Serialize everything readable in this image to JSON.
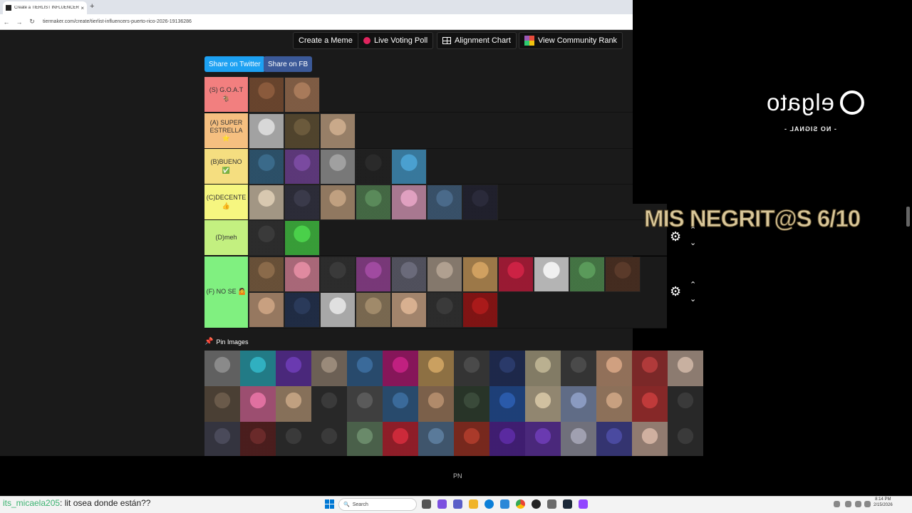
{
  "browser": {
    "tab_title": "Create a TIERLIST INFLUENCERS",
    "tab_close": "×",
    "new_tab": "+",
    "url": "tiermaker.com/create/tierlist-influencers-puerto-rico-2026-19136286",
    "nav": [
      "←",
      "→",
      "↻"
    ]
  },
  "toolbar": {
    "create_meme": "Create a Meme",
    "live_voting": "Live Voting Poll",
    "alignment_chart": "Alignment Chart",
    "community_rank": "View Community Rank"
  },
  "share": {
    "twitter": "Share on Twitter",
    "facebook": "Share on FB"
  },
  "tiers": [
    {
      "label": "(S) G.O.A.T 🐐",
      "color": "#f27f7f",
      "count": 2,
      "thumbs": [
        "#8a5a3c",
        "#a87a5a"
      ]
    },
    {
      "label": "(A) SUPER ESTRELLA ⭐",
      "color": "#f5bf80",
      "count": 3,
      "thumbs": [
        "#d8d8d8",
        "#6b5a3c",
        "#c9a98a"
      ]
    },
    {
      "label": "(B)BUENO ✅",
      "color": "#f5de80",
      "count": 5,
      "thumbs": [
        "#3a6a8a",
        "#7a4aa0",
        "#a0a0a0",
        "#2a2a2a",
        "#4aa0d0"
      ]
    },
    {
      "label": "(C)DECENTE 👍",
      "color": "#f6f680",
      "count": 7,
      "thumbs": [
        "#d8c8b0",
        "#3a3a4a",
        "#c0a080",
        "#5a8a5a",
        "#e0a0c0",
        "#4a6a8a",
        "#2a2a3a"
      ]
    },
    {
      "label": "(D)meh",
      "color": "#c3f080",
      "count": 2,
      "thumbs": [
        "#3a3a3a",
        "#4ad04a"
      ]
    },
    {
      "label": "(F) NO SE 🤷",
      "color": "#80f080",
      "count": 18,
      "thumbs": [
        "#8a6a4a",
        "#e08aa0",
        "#3a3a3a",
        "#a04aa0",
        "#6a6a7a",
        "#b0a090",
        "#d0a060",
        "#cc2244",
        "#f0f0f0",
        "#5a9a5a",
        "#5a3a2a",
        "#c8a080",
        "#2a3a5a",
        "#e0e0e0",
        "#a08a6a",
        "#d8b090",
        "#3a3a3a",
        "#aa1a1a"
      ]
    }
  ],
  "pin_images": {
    "label": "Pin Images",
    "thumbs": [
      "#8a8a8a",
      "#30b0c0",
      "#6a3ab0",
      "#9a8a7a",
      "#3a6a9a",
      "#c02080",
      "#caa060",
      "#4a4a4a",
      "#2a3a6a",
      "#bab090",
      "#4a4a4a",
      "#d0a080",
      "#b03a3a",
      "#c8b0a0",
      "#6a5a4a",
      "#e070a0",
      "#c0a080",
      "#3a3a3a",
      "#5a5a5a",
      "#3a6a9a",
      "#b08a6a",
      "#3a4a3a",
      "#2a5aaa",
      "#d0c0a0",
      "#8a9ac0",
      "#c8a080",
      "#c03a3a",
      "#3a3a3a",
      "#4a4a5a",
      "#6a2a2a",
      "#3a3a3a",
      "#3a3a3a",
      "#6a8a6a",
      "#cc2a3a",
      "#5a7a9a",
      "#aa3a2a",
      "#5a2aa0",
      "#6a3ab0",
      "#a0a0b0",
      "#4a4aa0",
      "#d0b0a0",
      "#3a3a3a"
    ]
  },
  "overlay": {
    "brand": "elgato",
    "no_signal": "- NO SIGNAL -",
    "title": "MIS NEGRIT@S 6/10"
  },
  "footer_text": "PN",
  "chat": {
    "user": "its_micaela205",
    "message": ": lit osea donde están??"
  },
  "taskbar": {
    "search": "Search",
    "time": "8:14 PM",
    "date": "2/15/2026"
  }
}
